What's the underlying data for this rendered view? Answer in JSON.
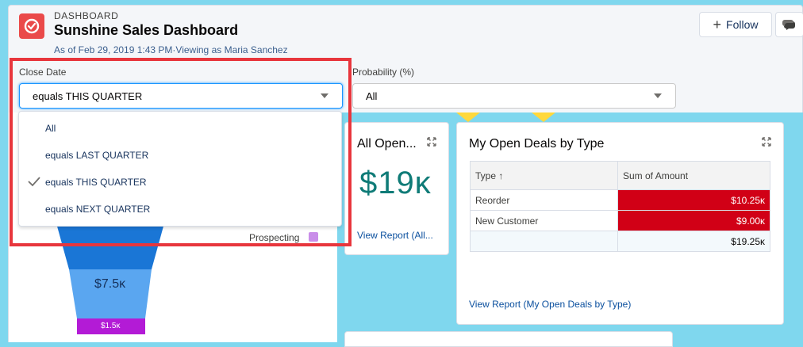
{
  "header": {
    "eyebrow": "DASHBOARD",
    "title": "Sunshine Sales Dashboard",
    "subtitle": "As of Feb 29, 2019 1:43 PM·Viewing as Maria Sanchez",
    "follow_label": "Follow"
  },
  "filters": [
    {
      "label": "Close Date",
      "value": "equals THIS QUARTER"
    },
    {
      "label": "Probability (%)",
      "value": "All"
    }
  ],
  "close_date_options": [
    {
      "label": "All",
      "selected": false
    },
    {
      "label": "equals LAST QUARTER",
      "selected": false
    },
    {
      "label": "equals THIS QUARTER",
      "selected": true
    },
    {
      "label": "equals NEXT QUARTER",
      "selected": false
    }
  ],
  "funnel": {
    "legend": "Prospecting",
    "value_main": "$7.5ĸ",
    "value_small": "$1.5ĸ"
  },
  "all_open_card": {
    "title": "All Open...",
    "metric": "$19ĸ",
    "link": "View Report (All..."
  },
  "deals_card": {
    "title": "My Open Deals by Type",
    "columns": [
      "Type ↑",
      "Sum of Amount"
    ],
    "rows": [
      {
        "type": "Reorder",
        "amount": "$10.25ĸ"
      },
      {
        "type": "New Customer",
        "amount": "$9.00ĸ"
      }
    ],
    "total": "$19.25ĸ",
    "link": "View Report (My Open Deals by Type)"
  },
  "colors": {
    "accent_red": "#d10016",
    "metric_teal": "#0f7b77",
    "funnel_blue": "#1a76d6",
    "funnel_purple": "#b31bd6",
    "background": "#7fd7ee"
  }
}
